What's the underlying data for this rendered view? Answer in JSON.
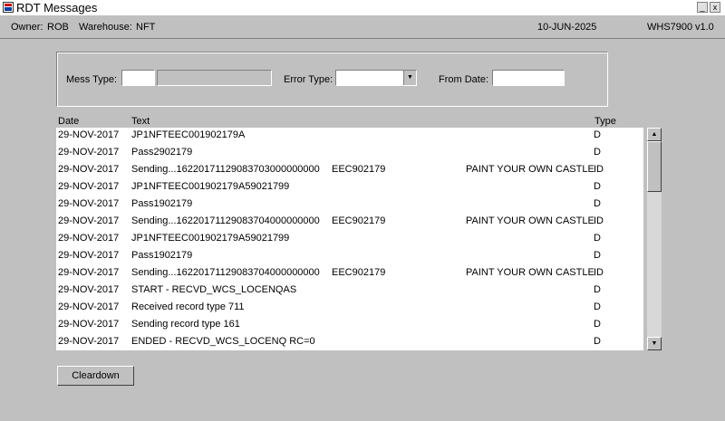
{
  "window": {
    "title": "RDT Messages",
    "minimize_glyph": "_",
    "close_glyph": "x"
  },
  "status": {
    "owner_label": "Owner:",
    "owner_value": "ROB",
    "warehouse_label": "Warehouse:",
    "warehouse_value": "NFT",
    "date": "10-JUN-2025",
    "module": "WHS7900",
    "version": "v1.0"
  },
  "filters": {
    "mess_type_label": "Mess Type:",
    "mess_type_value": "",
    "mess_type_desc": "",
    "error_type_label": "Error Type:",
    "error_type_value": "",
    "from_date_label": "From Date:",
    "from_date_value": ""
  },
  "table": {
    "columns": {
      "date": "Date",
      "text": "Text",
      "type": "Type"
    },
    "rows": [
      {
        "date": "29-NOV-2017",
        "text": "JP1NFTEEC001902179A",
        "ref": "",
        "desc": "",
        "type": "D"
      },
      {
        "date": "29-NOV-2017",
        "text": "Pass2902179",
        "ref": "",
        "desc": "",
        "type": "D"
      },
      {
        "date": "29-NOV-2017",
        "text": "Sending...16220171129083703000000000",
        "ref": "EEC902179",
        "desc": "PAINT YOUR OWN CASTLE",
        "type": "ID"
      },
      {
        "date": "29-NOV-2017",
        "text": "JP1NFTEEC001902179A59021799",
        "ref": "",
        "desc": "",
        "type": "D"
      },
      {
        "date": "29-NOV-2017",
        "text": "Pass1902179",
        "ref": "",
        "desc": "",
        "type": "D"
      },
      {
        "date": "29-NOV-2017",
        "text": "Sending...16220171129083704000000000",
        "ref": "EEC902179",
        "desc": "PAINT YOUR OWN CASTLE",
        "type": "ID"
      },
      {
        "date": "29-NOV-2017",
        "text": "JP1NFTEEC001902179A59021799",
        "ref": "",
        "desc": "",
        "type": "D"
      },
      {
        "date": "29-NOV-2017",
        "text": "Pass1902179",
        "ref": "",
        "desc": "",
        "type": "D"
      },
      {
        "date": "29-NOV-2017",
        "text": "Sending...16220171129083704000000000",
        "ref": "EEC902179",
        "desc": "PAINT YOUR OWN CASTLE",
        "type": "ID"
      },
      {
        "date": "29-NOV-2017",
        "text": "START - RECVD_WCS_LOCENQAS",
        "ref": "",
        "desc": "",
        "type": "D"
      },
      {
        "date": "29-NOV-2017",
        "text": "Received record type 711",
        "ref": "",
        "desc": "",
        "type": "D"
      },
      {
        "date": "29-NOV-2017",
        "text": "Sending record type 161",
        "ref": "",
        "desc": "",
        "type": "D"
      },
      {
        "date": "29-NOV-2017",
        "text": "ENDED - RECVD_WCS_LOCENQ RC=0",
        "ref": "",
        "desc": "",
        "type": "D"
      }
    ]
  },
  "buttons": {
    "cleardown": "Cleardown"
  },
  "scrollbar": {
    "up_glyph": "▲",
    "down_glyph": "▼"
  },
  "icons": {
    "app": "app-icon",
    "dropdown": "chevron-down-icon"
  }
}
